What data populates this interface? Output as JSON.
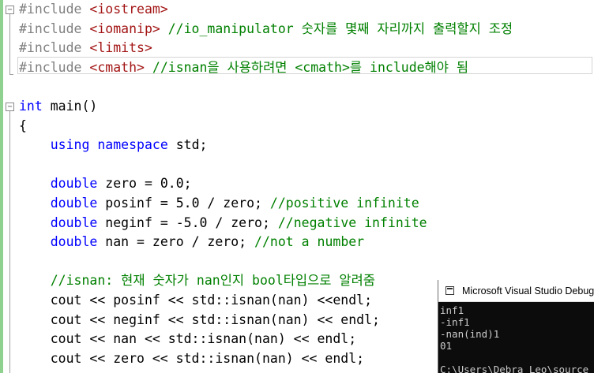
{
  "editor": {
    "lines": [
      {
        "fold": "minus",
        "tokens": [
          {
            "t": "#include ",
            "c": "pp"
          },
          {
            "t": "<iostream>",
            "c": "str"
          }
        ]
      },
      {
        "fold": "",
        "tokens": [
          {
            "t": "#include ",
            "c": "pp"
          },
          {
            "t": "<iomanip>",
            "c": "str"
          },
          {
            "t": " //io_manipulator 숫자를 몇째 자리까지 출력할지 조정",
            "c": "cm"
          }
        ]
      },
      {
        "fold": "",
        "tokens": [
          {
            "t": "#include ",
            "c": "pp"
          },
          {
            "t": "<limits>",
            "c": "str"
          }
        ]
      },
      {
        "fold": "",
        "tokens": [
          {
            "t": "#include ",
            "c": "pp"
          },
          {
            "t": "<cmath>",
            "c": "str"
          },
          {
            "t": " //isnan을 사용하려면 <cmath>를 include해야 됨",
            "c": "cm"
          }
        ]
      },
      {
        "fold": "",
        "tokens": []
      },
      {
        "fold": "minus",
        "tokens": [
          {
            "t": "int",
            "c": "kw"
          },
          {
            "t": " main()",
            "c": "fn"
          }
        ]
      },
      {
        "fold": "",
        "tokens": [
          {
            "t": "{",
            "c": "fn"
          }
        ]
      },
      {
        "fold": "",
        "tokens": [
          {
            "t": "    ",
            "c": "fn"
          },
          {
            "t": "using",
            "c": "kw"
          },
          {
            "t": " ",
            "c": "fn"
          },
          {
            "t": "namespace",
            "c": "kw"
          },
          {
            "t": " std;",
            "c": "fn"
          }
        ]
      },
      {
        "fold": "",
        "tokens": []
      },
      {
        "fold": "",
        "tokens": [
          {
            "t": "    ",
            "c": "fn"
          },
          {
            "t": "double",
            "c": "kw"
          },
          {
            "t": " zero = 0.0;",
            "c": "fn"
          }
        ]
      },
      {
        "fold": "",
        "tokens": [
          {
            "t": "    ",
            "c": "fn"
          },
          {
            "t": "double",
            "c": "kw"
          },
          {
            "t": " posinf = 5.0 / zero; ",
            "c": "fn"
          },
          {
            "t": "//positive infinite",
            "c": "cm"
          }
        ]
      },
      {
        "fold": "",
        "tokens": [
          {
            "t": "    ",
            "c": "fn"
          },
          {
            "t": "double",
            "c": "kw"
          },
          {
            "t": " neginf = -5.0 / zero; ",
            "c": "fn"
          },
          {
            "t": "//negative infinite",
            "c": "cm"
          }
        ]
      },
      {
        "fold": "",
        "tokens": [
          {
            "t": "    ",
            "c": "fn"
          },
          {
            "t": "double",
            "c": "kw"
          },
          {
            "t": " nan = zero / zero; ",
            "c": "fn"
          },
          {
            "t": "//not a number",
            "c": "cm"
          }
        ]
      },
      {
        "fold": "",
        "tokens": []
      },
      {
        "fold": "",
        "tokens": [
          {
            "t": "    ",
            "c": "fn"
          },
          {
            "t": "//isnan: 현재 숫자가 nan인지 bool타입으로 알려줌",
            "c": "cm"
          }
        ]
      },
      {
        "fold": "",
        "tokens": [
          {
            "t": "    cout << posinf << std::isnan(nan) <<endl;",
            "c": "fn"
          }
        ]
      },
      {
        "fold": "",
        "tokens": [
          {
            "t": "    cout << neginf << std::isnan(nan) << endl;",
            "c": "fn"
          }
        ]
      },
      {
        "fold": "",
        "tokens": [
          {
            "t": "    cout << nan << std::isnan(nan) << endl;",
            "c": "fn"
          }
        ]
      },
      {
        "fold": "",
        "tokens": [
          {
            "t": "    cout << zero << std::isnan(nan) << endl;",
            "c": "fn"
          }
        ]
      }
    ]
  },
  "console": {
    "title": "Microsoft Visual Studio Debug",
    "lines": [
      "inf1",
      "-inf1",
      "-nan(ind)1",
      "01",
      "",
      "C:\\Users\\Debra_Leo\\source"
    ]
  }
}
